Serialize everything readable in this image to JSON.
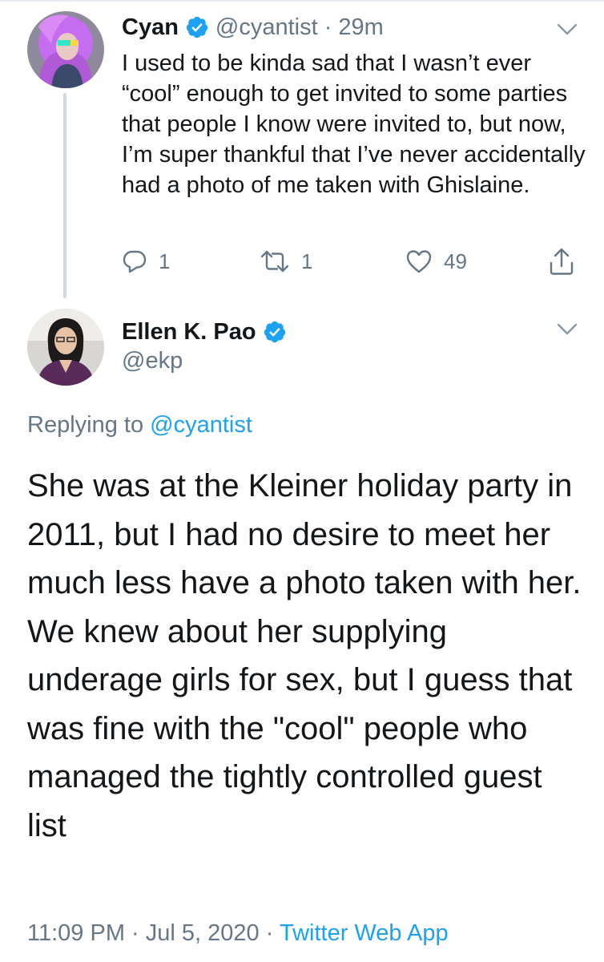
{
  "parent_tweet": {
    "display_name": "Cyan",
    "handle": "@cyantist",
    "separator": "·",
    "time": "29m",
    "text": "I used to be kinda sad that I wasn’t ever “cool” enough to get invited to some parties that people I know were invited to, but now, I’m super thankful that I’ve never accidentally had a photo of me taken with Ghislaine.",
    "reply_count": "1",
    "retweet_count": "1",
    "like_count": "49"
  },
  "main_tweet": {
    "display_name": "Ellen K. Pao",
    "handle": "@ekp",
    "replying_prefix": "Replying to",
    "replying_to": "@cyantist",
    "text": "She was at the Kleiner holiday party in 2011, but I had no desire to meet her much less have a photo taken with her. We knew about her supplying underage girls for sex, but I guess that was fine with the \"cool\" people who managed the tightly controlled guest list",
    "time": "11:09 PM",
    "separator1": "·",
    "date": "Jul 5, 2020",
    "separator2": "·",
    "source": "Twitter Web App"
  },
  "colors": {
    "accent": "#1da1f2",
    "secondary_text": "#657786",
    "primary_text": "#14171a",
    "thread_line": "#cfd9de"
  },
  "icons": [
    "verified-icon",
    "chevron-down-icon",
    "reply-icon",
    "retweet-icon",
    "like-icon",
    "share-icon"
  ]
}
